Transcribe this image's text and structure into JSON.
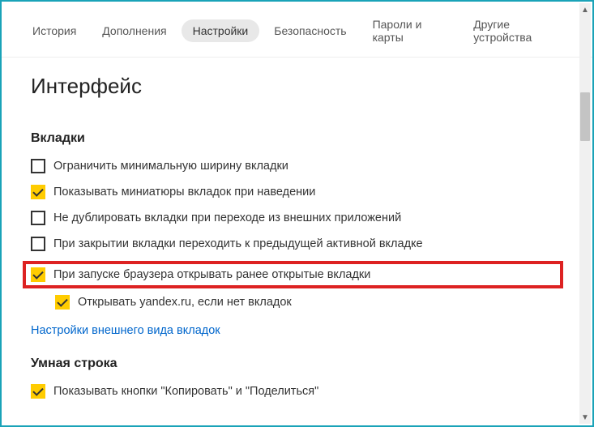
{
  "tabs": {
    "history": "История",
    "addons": "Дополнения",
    "settings": "Настройки",
    "security": "Безопасность",
    "passwords": "Пароли и карты",
    "devices": "Другие устройства"
  },
  "page_title": "Интерфейс",
  "sections": {
    "tabs_section": {
      "title": "Вкладки",
      "options": {
        "limit_min_width": "Ограничить минимальную ширину вкладки",
        "show_thumbnails": "Показывать миниатюры вкладок при наведении",
        "no_duplicate": "Не дублировать вкладки при переходе из внешних приложений",
        "prev_active": "При закрытии вкладки переходить к предыдущей активной вкладке",
        "restore_on_start": "При запуске браузера открывать ранее открытые вкладки",
        "open_yandex": "Открывать yandex.ru, если нет вкладок"
      },
      "link": "Настройки внешнего вида вкладок"
    },
    "smart_line": {
      "title": "Умная строка",
      "options": {
        "show_copy_share": "Показывать кнопки \"Копировать\" и \"Поделиться\""
      }
    }
  }
}
